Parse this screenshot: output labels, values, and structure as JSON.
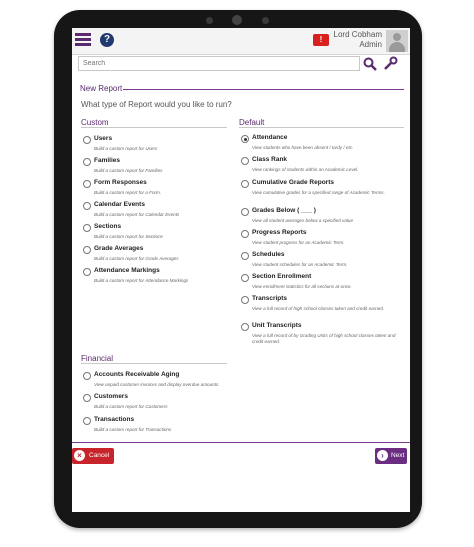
{
  "header": {
    "user_name": "Lord Cobham",
    "user_role": "Admin",
    "help_label": "?",
    "alert_label": "!"
  },
  "search": {
    "placeholder": "Search"
  },
  "page": {
    "title": "New Report",
    "question": "What type of Report would you like to run?"
  },
  "custom": {
    "heading": "Custom",
    "items": [
      {
        "label": "Users",
        "desc": "Build a custom report for Users"
      },
      {
        "label": "Families",
        "desc": "Build a custom report for Families"
      },
      {
        "label": "Form Responses",
        "desc": "Build a custom report for a Form."
      },
      {
        "label": "Calendar Events",
        "desc": "Build a custom report for Calendar Events"
      },
      {
        "label": "Sections",
        "desc": "Build a custom report for Sections"
      },
      {
        "label": "Grade Averages",
        "desc": "Build a custom report for Grade Averages"
      },
      {
        "label": "Attendance Markings",
        "desc": "Build a custom report for Attendance Markings"
      }
    ]
  },
  "default": {
    "heading": "Default",
    "items": [
      {
        "label": "Attendance",
        "desc": "View students who have been absent / tardy / etc.",
        "checked": true
      },
      {
        "label": "Class Rank",
        "desc": "View rankings of students within an Academic Level."
      },
      {
        "label": "Cumulative Grade Reports",
        "desc": "View cumulative grades for a specified range of Academic Terms."
      },
      {
        "label": "Grades Below ( ___ )",
        "desc": "View all student averages below a specified value"
      },
      {
        "label": "Progress Reports",
        "desc": "View student progress for an Academic Term."
      },
      {
        "label": "Schedules",
        "desc": "View student schedules for an Academic Term."
      },
      {
        "label": "Section Enrollment",
        "desc": "View enrollment statistics for all sections at once."
      },
      {
        "label": "Transcripts",
        "desc": "View a full record of high school classes taken and credit earned."
      },
      {
        "label": "Unit Transcripts",
        "desc": "View a full record of by Grading Units of high school classes taken and credit earned."
      }
    ]
  },
  "financial": {
    "heading": "Financial",
    "items": [
      {
        "label": "Accounts Receivable Aging",
        "desc": "View unpaid customer invoices and display overdue amounts."
      },
      {
        "label": "Customers",
        "desc": "Build a custom report for Customers"
      },
      {
        "label": "Transactions",
        "desc": "Build a custom report for Transactions"
      }
    ]
  },
  "footer": {
    "cancel_label": "Cancel",
    "next_label": "Next"
  },
  "colors": {
    "accent": "#5a2a6e",
    "cancel": "#c8242b",
    "next": "#6a2d82",
    "alert": "#d8201f"
  },
  "icons": [
    "hamburger-icon",
    "help-icon",
    "alert-icon",
    "avatar-icon",
    "search-icon",
    "wrench-icon",
    "cancel-x-icon",
    "next-arrow-icon"
  ]
}
